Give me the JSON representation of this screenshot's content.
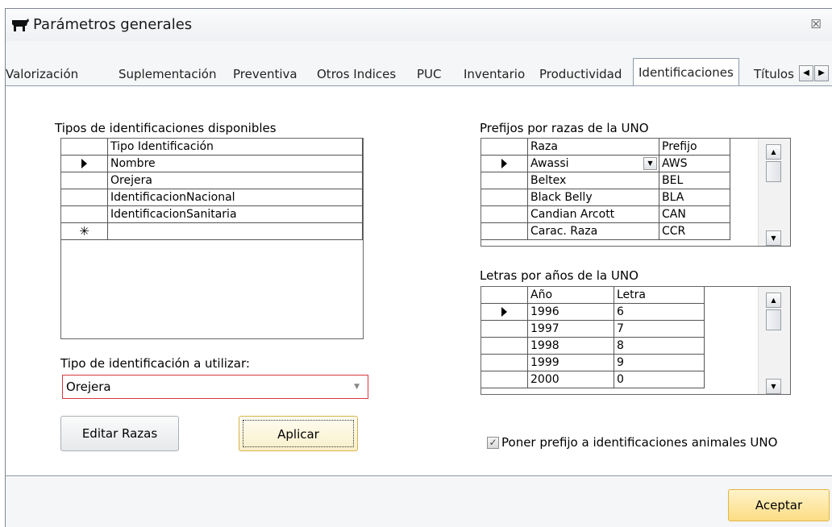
{
  "window": {
    "title": "Parámetros generales",
    "close_glyph": "☒"
  },
  "tabs": [
    {
      "label": "Valorización"
    },
    {
      "label": "Suplementación"
    },
    {
      "label": "Preventiva"
    },
    {
      "label": "Otros Indices"
    },
    {
      "label": "PUC"
    },
    {
      "label": "Inventario"
    },
    {
      "label": "Productividad"
    },
    {
      "label": "Identificaciones",
      "active": true
    },
    {
      "label": "Títulos"
    }
  ],
  "tab_scroll": {
    "left": "◀",
    "right": "▶"
  },
  "tipos": {
    "label": "Tipos de identificaciones disponibles",
    "header": "Tipo Identificación",
    "rows": [
      "Nombre",
      "Orejera",
      "IdentificacionNacional",
      "IdentificacionSanitaria"
    ],
    "new_row_glyph": "✳"
  },
  "tipo_utilizar": {
    "label": "Tipo de identificación a utilizar:",
    "value": "Orejera"
  },
  "prefijos": {
    "label": "Prefijos por razas de la UNO",
    "headers": [
      "Raza",
      "Prefijo"
    ],
    "rows": [
      {
        "raza": "Awassi",
        "prefijo": "AWS"
      },
      {
        "raza": "Beltex",
        "prefijo": "BEL"
      },
      {
        "raza": "Black Belly",
        "prefijo": "BLA"
      },
      {
        "raza": "Candian Arcott",
        "prefijo": "CAN"
      },
      {
        "raza": "Carac. Raza",
        "prefijo": "CCR"
      }
    ]
  },
  "letras": {
    "label": "Letras por años de la UNO",
    "headers": [
      "Año",
      "Letra"
    ],
    "rows": [
      {
        "anio": "1996",
        "letra": "6"
      },
      {
        "anio": "1997",
        "letra": "7"
      },
      {
        "anio": "1998",
        "letra": "8"
      },
      {
        "anio": "1999",
        "letra": "9"
      },
      {
        "anio": "2000",
        "letra": "0"
      }
    ]
  },
  "buttons": {
    "editar": "Editar Razas",
    "aplicar": "Aplicar",
    "aceptar": "Aceptar"
  },
  "prefix_checkbox": {
    "label": "Poner prefijo a identificaciones animales UNO",
    "checked": true
  }
}
